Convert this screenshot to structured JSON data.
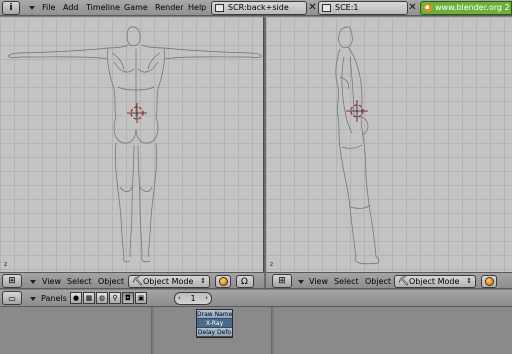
{
  "topbar": {
    "menus": [
      "File",
      "Add",
      "Timeline",
      "Game",
      "Render",
      "Help"
    ],
    "screen": "SCR:back+side",
    "scene": "SCE:1",
    "url": "www.blender.org 2"
  },
  "viewports": {
    "left": {
      "axis": "z"
    },
    "right": {
      "axis": "z"
    }
  },
  "view_header": {
    "menus": [
      "View",
      "Select",
      "Object"
    ],
    "mode": "Object Mode",
    "mode_icon": "object-mode-icon"
  },
  "buttons_header": {
    "panels_label": "Panels",
    "frame": "1"
  },
  "popup_menu": {
    "items": [
      "Draw Name",
      "X-Ray",
      "Delay Defo"
    ],
    "selected_index": 1
  },
  "colors": {
    "viewport_bg": "#c3c3c3",
    "grid": "#b3b3b3",
    "header": "#989898",
    "url_accent": "#6cb13e",
    "cursor": "#c0141c"
  }
}
